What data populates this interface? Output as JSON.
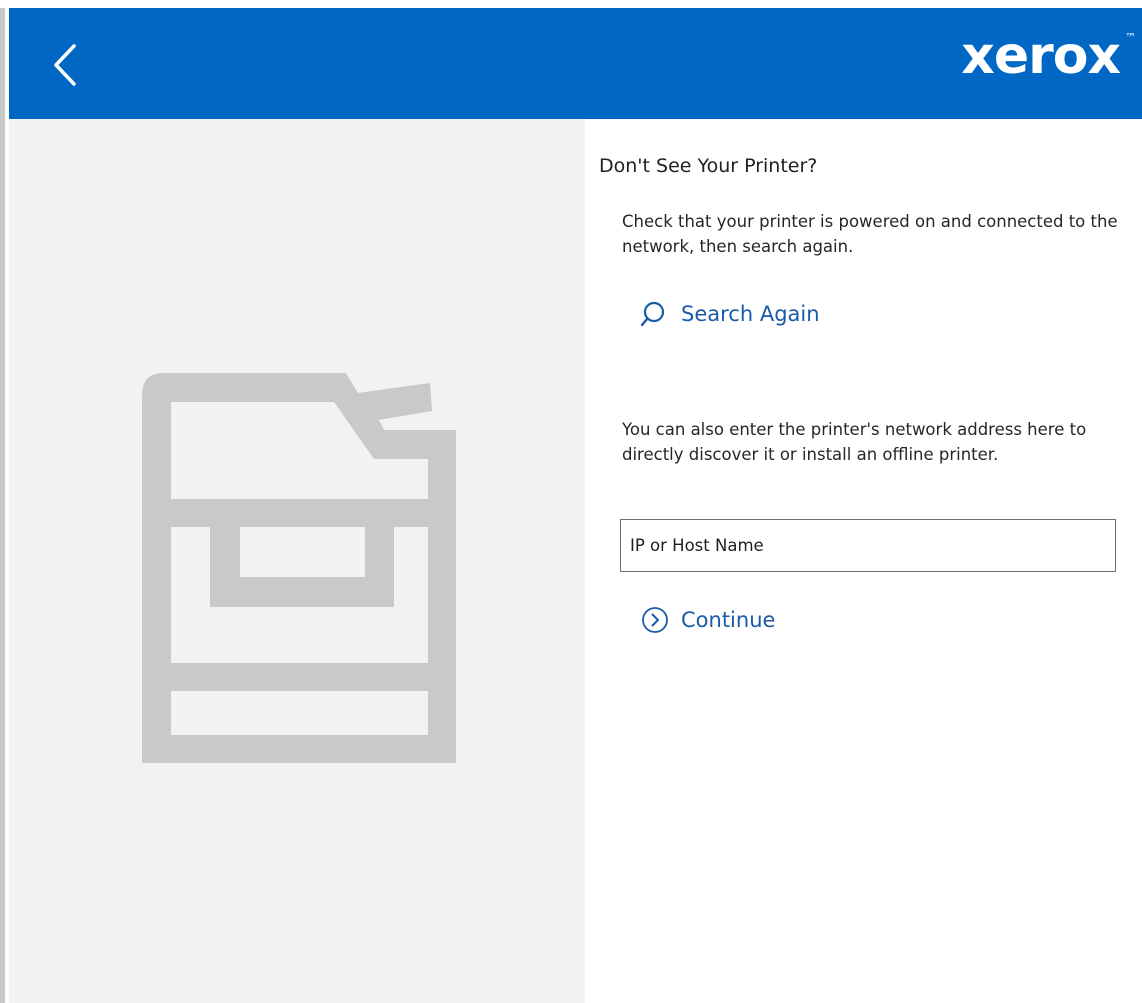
{
  "header": {
    "back_icon": "chevron-left-icon",
    "brand": {
      "name": "xerox",
      "trademark": "™"
    },
    "background_color": "#0067c5"
  },
  "illustration": {
    "icon": "printer-icon",
    "color": "#c9c9c9",
    "panel_color": "#f2f2f2"
  },
  "content": {
    "title": "Don't See Your Printer?",
    "check_message": "Check that your printer is powered on and connected to the network, then search again.",
    "search_again": {
      "label": "Search Again",
      "icon": "search-icon"
    },
    "address_message": "You can also enter the printer's network address here to directly discover it or install an offline printer.",
    "address_input": {
      "value": "",
      "placeholder": "IP or Host Name"
    },
    "continue": {
      "label": "Continue",
      "icon": "chevron-right-circle-icon"
    },
    "link_color": "#1a5aa8"
  }
}
